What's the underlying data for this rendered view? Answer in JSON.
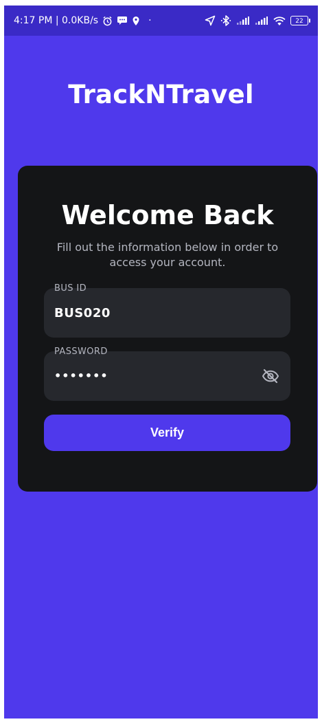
{
  "status_bar": {
    "time_info": "4:17 PM | 0.0KB/s",
    "dot": "·",
    "battery": "22",
    "icons_left": [
      "alarm-icon",
      "message-icon",
      "location-pin-icon"
    ],
    "icons_right": [
      "navigation-icon",
      "bluetooth-icon",
      "signal-icon",
      "signal-icon",
      "wifi-icon",
      "battery-icon"
    ]
  },
  "app": {
    "title": "TrackNTravel"
  },
  "card": {
    "heading": "Welcome Back",
    "subtitle": "Fill out the information below in order to access your account."
  },
  "form": {
    "bus_id": {
      "label": "BUS ID",
      "value": "BUS020"
    },
    "password": {
      "label": "PASSWORD",
      "value": "•••••••"
    },
    "submit_label": "Verify"
  },
  "colors": {
    "background": "#4f39ec",
    "status_bar": "#3a2ac6",
    "card": "#141517",
    "field": "#26282d",
    "button": "#4f39ec"
  }
}
